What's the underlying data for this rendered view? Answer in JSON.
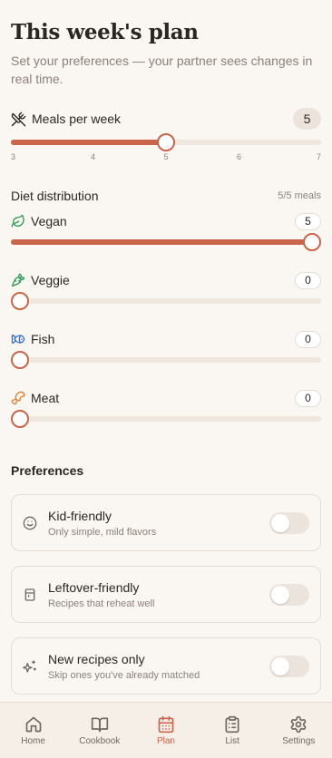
{
  "header": {
    "title": "This week's plan",
    "subtitle": "Set your preferences — your partner sees changes in real time."
  },
  "meals": {
    "label": "Meals per week",
    "value": 5,
    "min": 3,
    "max": 7,
    "ticks": [
      "3",
      "4",
      "5",
      "6",
      "7"
    ],
    "icon": "utensils-crossed-icon"
  },
  "distribution": {
    "heading": "Diet distribution",
    "count": "5/5 meals",
    "max": 5,
    "items": [
      {
        "label": "Vegan",
        "value": 5,
        "icon": "leaf-icon",
        "color": "#2e9a55"
      },
      {
        "label": "Veggie",
        "value": 0,
        "icon": "carrot-icon",
        "color": "#2e9a55"
      },
      {
        "label": "Fish",
        "value": 0,
        "icon": "fish-icon",
        "color": "#2f6fd6"
      },
      {
        "label": "Meat",
        "value": 0,
        "icon": "drumstick-icon",
        "color": "#e0832c"
      }
    ]
  },
  "preferences": {
    "heading": "Preferences",
    "items": [
      {
        "title": "Kid-friendly",
        "desc": "Only simple, mild flavors",
        "on": false,
        "icon": "smile-icon"
      },
      {
        "title": "Leftover-friendly",
        "desc": "Recipes that reheat well",
        "on": false,
        "icon": "container-icon"
      },
      {
        "title": "New recipes only",
        "desc": "Skip ones you've already matched",
        "on": false,
        "icon": "sparkles-icon"
      }
    ]
  },
  "nav": {
    "items": [
      {
        "label": "Home",
        "icon": "home-icon",
        "active": false
      },
      {
        "label": "Cookbook",
        "icon": "book-icon",
        "active": false
      },
      {
        "label": "Plan",
        "icon": "calendar-icon",
        "active": true
      },
      {
        "label": "List",
        "icon": "clipboard-list-icon",
        "active": false
      },
      {
        "label": "Settings",
        "icon": "gear-icon",
        "active": false
      }
    ]
  },
  "colors": {
    "accent": "#c9654b",
    "track": "#efe6de",
    "background": "#faf7f3",
    "muted_text": "#8a817a"
  }
}
